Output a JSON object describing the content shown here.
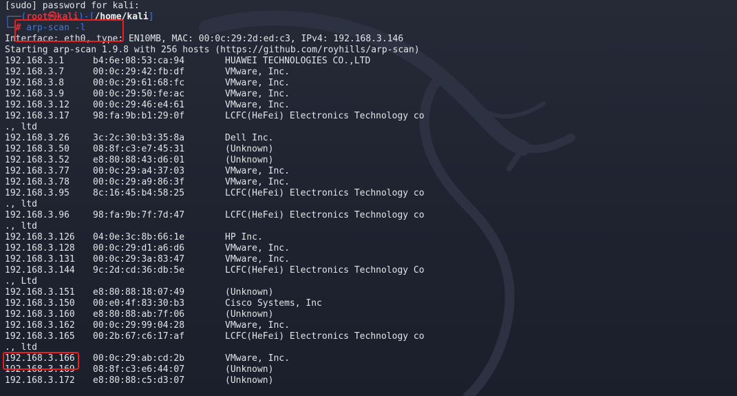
{
  "terminal": {
    "sudo_prompt": "[sudo] password for kali:",
    "prompt": {
      "corner_top": "┌──(",
      "user_host": "root㉿kali",
      "mid": ")-[",
      "path": "/home/kali",
      "end": "]",
      "corner_bottom": "└─",
      "symbol": "#",
      "command": "arp-scan -l"
    },
    "interface_line": "Interface: eth0, type: EN10MB, MAC: 00:0c:29:2d:ed:c3, IPv4: 192.168.3.146",
    "starting_line": "Starting arp-scan 1.9.8 with 256 hosts (https://github.com/royhills/arp-scan)",
    "rows": [
      {
        "ip": "192.168.3.1",
        "mac": "b4:6e:08:53:ca:94",
        "vendor": "HUAWEI TECHNOLOGIES CO.,LTD",
        "cont": ""
      },
      {
        "ip": "192.168.3.7",
        "mac": "00:0c:29:42:fb:df",
        "vendor": "VMware, Inc.",
        "cont": ""
      },
      {
        "ip": "192.168.3.8",
        "mac": "00:0c:29:61:68:fc",
        "vendor": "VMware, Inc.",
        "cont": ""
      },
      {
        "ip": "192.168.3.9",
        "mac": "00:0c:29:50:fe:ac",
        "vendor": "VMware, Inc.",
        "cont": ""
      },
      {
        "ip": "192.168.3.12",
        "mac": "00:0c:29:46:e4:61",
        "vendor": "VMware, Inc.",
        "cont": ""
      },
      {
        "ip": "192.168.3.17",
        "mac": "98:fa:9b:b1:29:0f",
        "vendor": "LCFC(HeFei) Electronics Technology co",
        "cont": "., ltd"
      },
      {
        "ip": "192.168.3.26",
        "mac": "3c:2c:30:b3:35:8a",
        "vendor": "Dell Inc.",
        "cont": ""
      },
      {
        "ip": "192.168.3.50",
        "mac": "08:8f:c3:e7:45:31",
        "vendor": "(Unknown)",
        "cont": ""
      },
      {
        "ip": "192.168.3.52",
        "mac": "e8:80:88:43:d6:01",
        "vendor": "(Unknown)",
        "cont": ""
      },
      {
        "ip": "192.168.3.77",
        "mac": "00:0c:29:a4:37:03",
        "vendor": "VMware, Inc.",
        "cont": ""
      },
      {
        "ip": "192.168.3.78",
        "mac": "00:0c:29:a9:86:3f",
        "vendor": "VMware, Inc.",
        "cont": ""
      },
      {
        "ip": "192.168.3.95",
        "mac": "8c:16:45:b4:58:25",
        "vendor": "LCFC(HeFei) Electronics Technology co",
        "cont": "., ltd"
      },
      {
        "ip": "192.168.3.96",
        "mac": "98:fa:9b:7f:7d:47",
        "vendor": "LCFC(HeFei) Electronics Technology co",
        "cont": "., ltd"
      },
      {
        "ip": "192.168.3.126",
        "mac": "04:0e:3c:8b:66:1e",
        "vendor": "HP Inc.",
        "cont": ""
      },
      {
        "ip": "192.168.3.128",
        "mac": "00:0c:29:d1:a6:d6",
        "vendor": "VMware, Inc.",
        "cont": ""
      },
      {
        "ip": "192.168.3.131",
        "mac": "00:0c:29:3a:83:47",
        "vendor": "VMware, Inc.",
        "cont": ""
      },
      {
        "ip": "192.168.3.144",
        "mac": "9c:2d:cd:36:db:5e",
        "vendor": "LCFC(HeFei) Electronics Technology Co",
        "cont": "., Ltd"
      },
      {
        "ip": "192.168.3.151",
        "mac": "e8:80:88:18:07:49",
        "vendor": "(Unknown)",
        "cont": ""
      },
      {
        "ip": "192.168.3.150",
        "mac": "00:e0:4f:83:30:b3",
        "vendor": "Cisco Systems, Inc",
        "cont": ""
      },
      {
        "ip": "192.168.3.160",
        "mac": "e8:80:88:ab:7f:06",
        "vendor": "(Unknown)",
        "cont": ""
      },
      {
        "ip": "192.168.3.162",
        "mac": "00:0c:29:99:04:28",
        "vendor": "VMware, Inc.",
        "cont": ""
      },
      {
        "ip": "192.168.3.165",
        "mac": "00:2b:67:c6:17:af",
        "vendor": "LCFC(HeFei) Electronics Technology co",
        "cont": "., ltd"
      },
      {
        "ip": "192.168.3.166",
        "mac": "00:0c:29:ab:cd:2b",
        "vendor": "VMware, Inc.",
        "cont": ""
      },
      {
        "ip": "192.168.3.169",
        "mac": "08:8f:c3:e6:44:07",
        "vendor": "(Unknown)",
        "cont": ""
      },
      {
        "ip": "192.168.3.172",
        "mac": "e8:80:88:c5:d3:07",
        "vendor": "(Unknown)",
        "cont": ""
      }
    ]
  },
  "colors": {
    "background": "#1f2230",
    "text": "#e2e4e8",
    "prompt_blue": "#3b78e7",
    "prompt_red": "#e2333a",
    "annotation_red": "#ee1c1c"
  },
  "icons": {
    "background_logo": "kali-dragon-icon"
  }
}
